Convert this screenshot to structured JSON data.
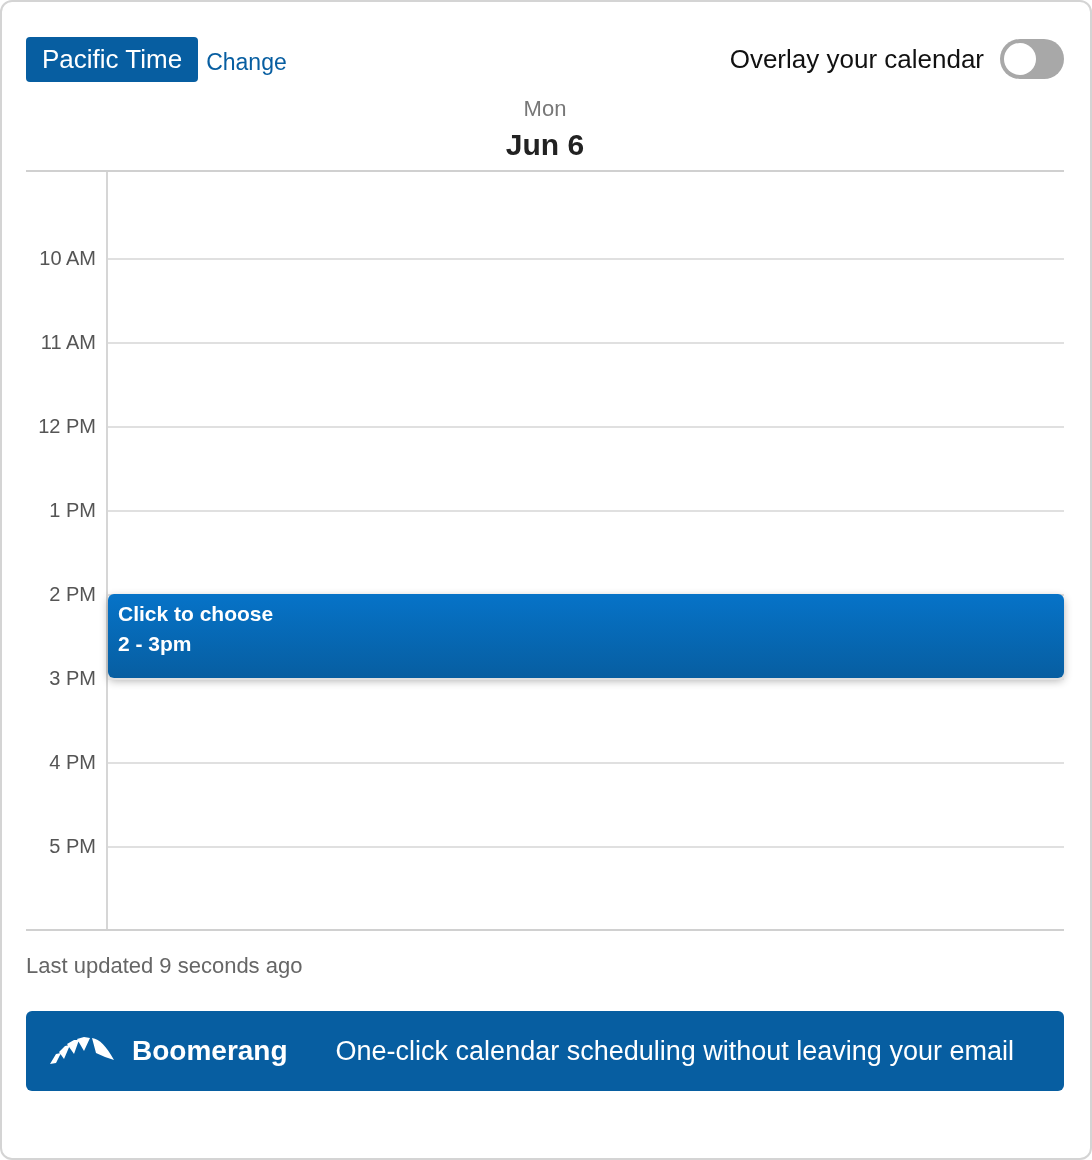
{
  "timezone": {
    "label": "Pacific Time",
    "change_link": "Change"
  },
  "overlay": {
    "label": "Overlay your calendar",
    "on": false
  },
  "day": {
    "weekday": "Mon",
    "date": "Jun 6"
  },
  "hours": [
    {
      "label": "10 AM"
    },
    {
      "label": "11 AM"
    },
    {
      "label": "12 PM"
    },
    {
      "label": "1 PM"
    },
    {
      "label": "2 PM",
      "event": {
        "title": "Click to choose",
        "time": "2 - 3pm"
      }
    },
    {
      "label": "3 PM"
    },
    {
      "label": "4 PM"
    },
    {
      "label": "5 PM"
    }
  ],
  "status": "Last updated 9 seconds ago",
  "banner": {
    "brand": "Boomerang",
    "tagline": "One-click calendar scheduling without leaving your email"
  }
}
